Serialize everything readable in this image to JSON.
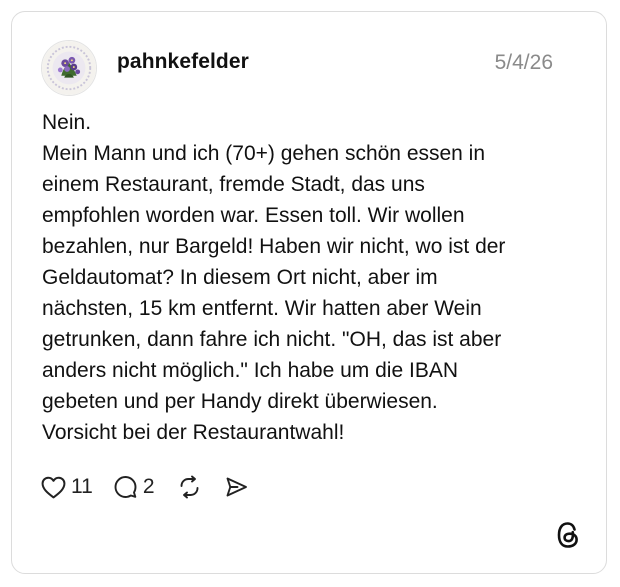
{
  "post": {
    "username": "pahnkefelder",
    "date": "5/4/26",
    "text_lines": [
      "Nein.",
      "Mein Mann und ich (70+) gehen schön essen in",
      "einem Restaurant, fremde Stadt, das uns",
      "empfohlen worden war. Essen toll. Wir wollen",
      "bezahlen, nur Bargeld! Haben wir nicht, wo ist der",
      "Geldautomat? In diesem Ort nicht, aber im",
      "nächsten, 15 km entfernt. Wir hatten aber Wein",
      "getrunken, dann fahre ich nicht. \"OH, das ist aber",
      "anders nicht möglich.\" Ich habe um die IBAN",
      "gebeten und per Handy direkt überwiesen.",
      "Vorsicht bei der Restaurantwahl!"
    ],
    "actions": {
      "like_icon": "heart-icon",
      "like_count": "11",
      "reply_icon": "speech-bubble-icon",
      "reply_count": "2",
      "repost_icon": "repost-icon",
      "share_icon": "send-icon"
    },
    "logo_icon": "threads-logo-icon"
  },
  "colors": {
    "text": "#111111",
    "muted": "#8a8a8a",
    "border": "#dcdcdc",
    "background": "#ffffff"
  }
}
